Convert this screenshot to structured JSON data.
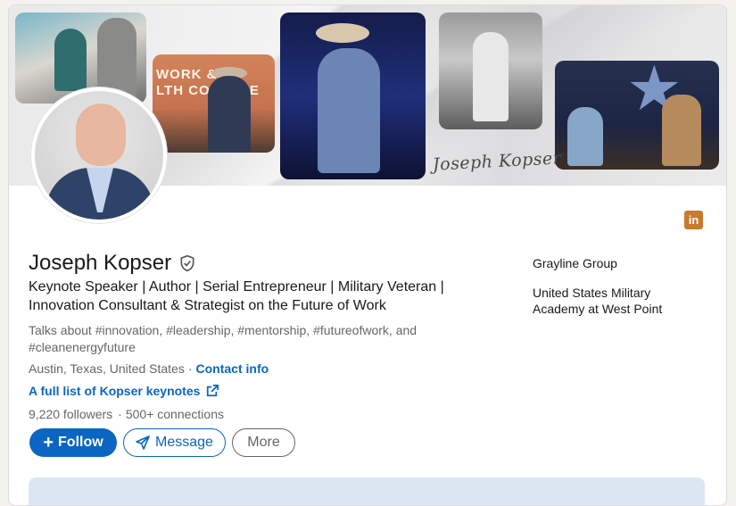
{
  "banner": {
    "signature": "Joseph Kopser",
    "event_sign": "WORK &\nLTH CONF ICE"
  },
  "profile": {
    "name": "Joseph Kopser",
    "headline": "Keynote Speaker | Author | Serial Entrepreneur | Military Veteran | Innovation Consultant & Strategist on the Future of Work",
    "talks_about": "Talks about #innovation, #leadership, #mentorship, #futureofwork, and #cleanenergyfuture",
    "location": "Austin, Texas, United States",
    "contact_info_label": "Contact info",
    "website_label": "A full list of Kopser keynotes",
    "followers": "9,220 followers",
    "connections": "500+ connections"
  },
  "actions": {
    "follow_label": "Follow",
    "message_label": "Message",
    "more_label": "More"
  },
  "experience": {
    "company": "Grayline Group",
    "school": "United States Military Academy at West Point"
  },
  "icons": {
    "verified": "shield-check-icon",
    "external_link": "external-link-icon",
    "message": "paper-plane-icon",
    "linkedin": "linkedin-icon"
  },
  "colors": {
    "brand_blue": "#0a66c2",
    "linkedin_badge": "#c97a2b",
    "text_primary": "#191919",
    "text_secondary": "#666666"
  }
}
